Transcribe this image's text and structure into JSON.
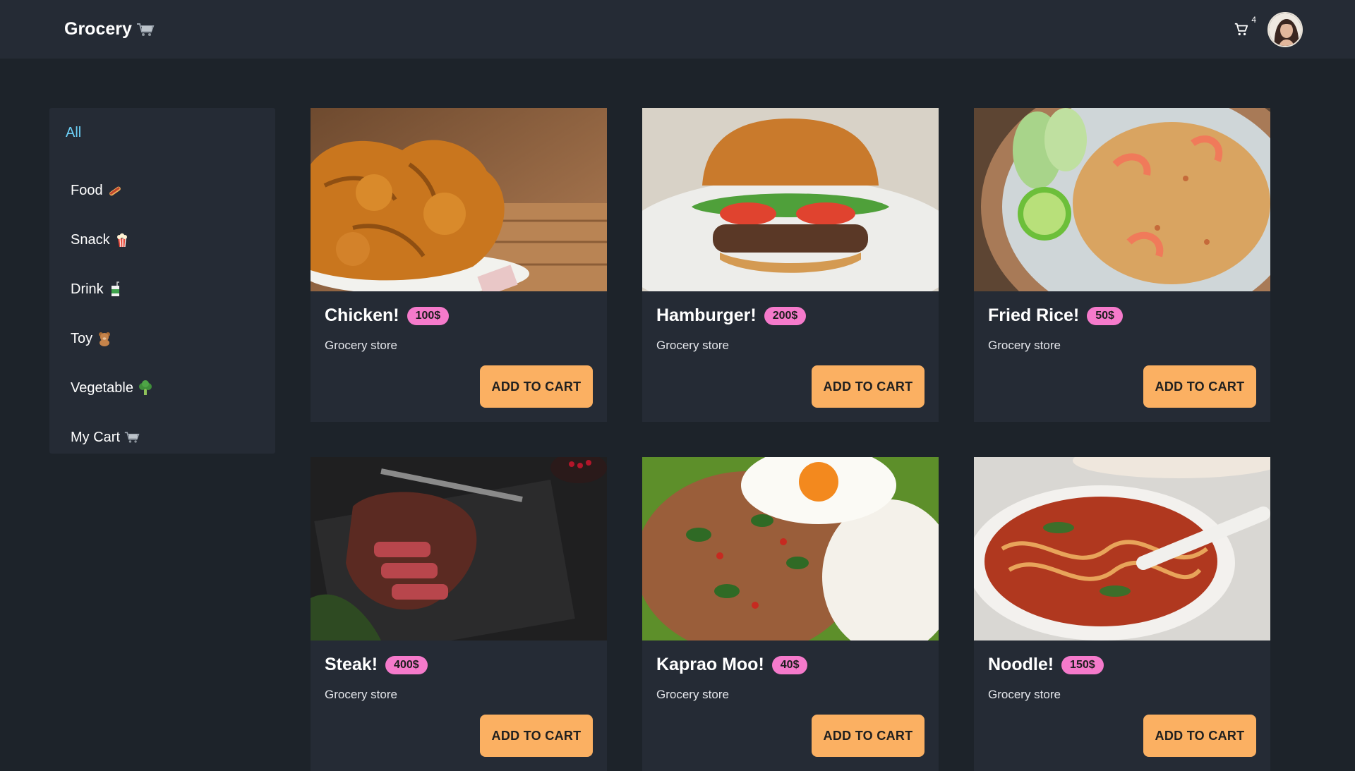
{
  "navbar": {
    "brand": "Grocery",
    "brand_icon": "shopping-cart-emoji",
    "cart_count": "4",
    "cart_icon": "cart-icon",
    "avatar_icon": "user-avatar"
  },
  "sidebar": {
    "items": [
      {
        "label": "All",
        "icon": ""
      },
      {
        "label": "Food",
        "icon": "hotdog-emoji"
      },
      {
        "label": "Snack",
        "icon": "popcorn-emoji"
      },
      {
        "label": "Drink",
        "icon": "juice-box-emoji"
      },
      {
        "label": "Toy",
        "icon": "teddy-bear-emoji"
      },
      {
        "label": "Vegetable",
        "icon": "broccoli-emoji"
      },
      {
        "label": "My Cart",
        "icon": "shopping-cart-emoji"
      }
    ]
  },
  "products": [
    {
      "name": "Chicken!",
      "price": "100$",
      "store": "Grocery store",
      "button": "ADD TO CART"
    },
    {
      "name": "Hamburger!",
      "price": "200$",
      "store": "Grocery store",
      "button": "ADD TO CART"
    },
    {
      "name": "Fried Rice!",
      "price": "50$",
      "store": "Grocery store",
      "button": "ADD TO CART"
    },
    {
      "name": "Steak!",
      "price": "400$",
      "store": "Grocery store",
      "button": "ADD TO CART"
    },
    {
      "name": "Kaprao Moo!",
      "price": "40$",
      "store": "Grocery store",
      "button": "ADD TO CART"
    },
    {
      "name": "Noodle!",
      "price": "150$",
      "store": "Grocery store",
      "button": "ADD TO CART"
    }
  ],
  "colors": {
    "background": "#1d232a",
    "surface": "#252b35",
    "active_category": "#6ccff6",
    "price_badge": "#f57acb",
    "button": "#fbb062"
  }
}
